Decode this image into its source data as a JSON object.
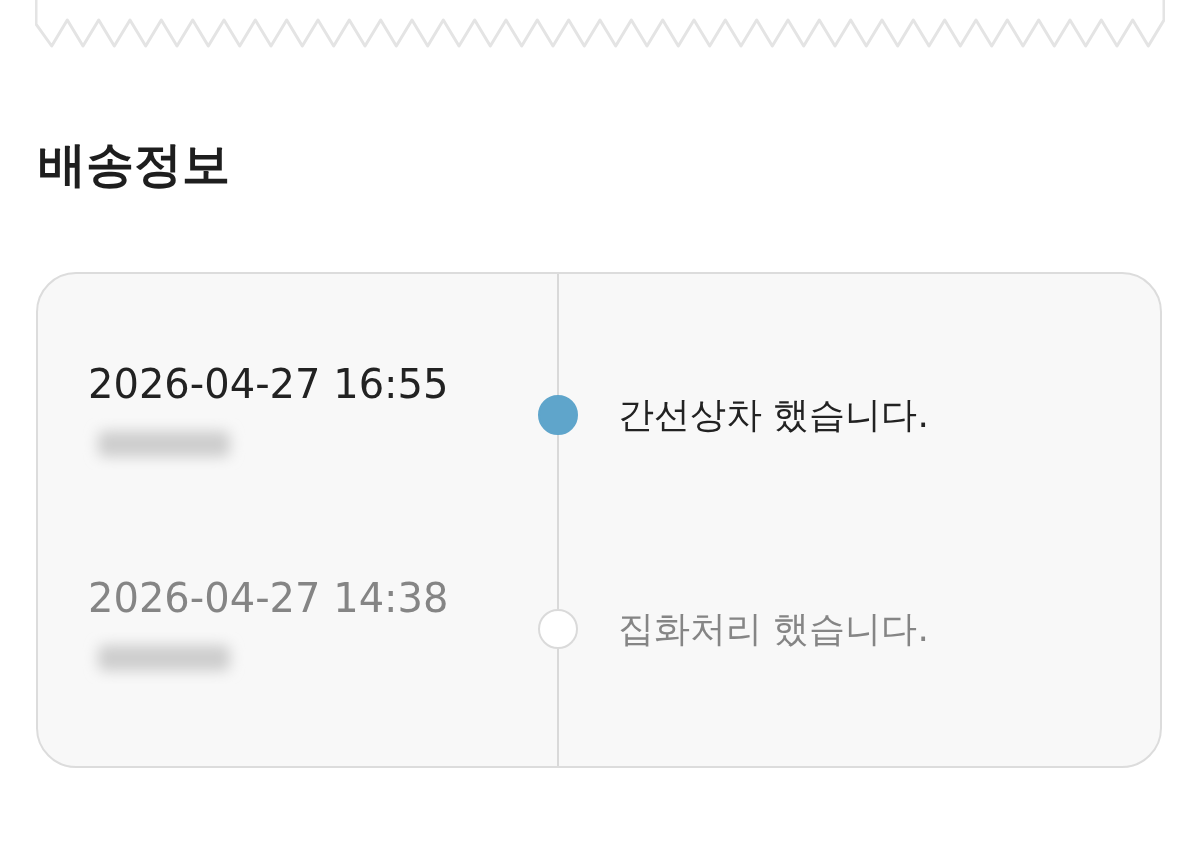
{
  "section_title": "배송정보",
  "tracking_events": [
    {
      "time": "2026-04-27 16:55",
      "location_blurred": true,
      "status": "간선상차 했습니다.",
      "current": true
    },
    {
      "time": "2026-04-27 14:38",
      "location_blurred": true,
      "status": "집화처리 했습니다.",
      "current": false
    }
  ]
}
